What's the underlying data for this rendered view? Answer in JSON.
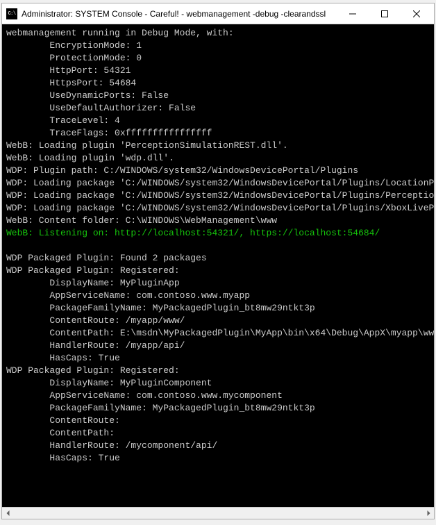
{
  "window": {
    "icon_label": "C:\\",
    "title": "Administrator:  SYSTEM Console - Careful! - webmanagement  -debug -clearandssl"
  },
  "console": {
    "lines": [
      {
        "text": "webmanagement running in Debug Mode, with:",
        "class": ""
      },
      {
        "text": "        EncryptionMode: 1",
        "class": ""
      },
      {
        "text": "        ProtectionMode: 0",
        "class": ""
      },
      {
        "text": "        HttpPort: 54321",
        "class": ""
      },
      {
        "text": "        HttpsPort: 54684",
        "class": ""
      },
      {
        "text": "        UseDynamicPorts: False",
        "class": ""
      },
      {
        "text": "        UseDefaultAuthorizer: False",
        "class": ""
      },
      {
        "text": "        TraceLevel: 4",
        "class": ""
      },
      {
        "text": "        TraceFlags: 0xffffffffffffffff",
        "class": ""
      },
      {
        "text": "WebB: Loading plugin 'PerceptionSimulationREST.dll'.",
        "class": ""
      },
      {
        "text": "WebB: Loading plugin 'wdp.dll'.",
        "class": ""
      },
      {
        "text": "WDP: Plugin path: C:/WINDOWS/system32/WindowsDevicePortal/Plugins",
        "class": ""
      },
      {
        "text": "WDP: Loading package 'C:/WINDOWS/system32/WindowsDevicePortal/Plugins/LocationPlugin",
        "class": ""
      },
      {
        "text": "WDP: Loading package 'C:/WINDOWS/system32/WindowsDevicePortal/Plugins/Perception/pac",
        "class": ""
      },
      {
        "text": "WDP: Loading package 'C:/WINDOWS/system32/WindowsDevicePortal/Plugins/XboxLivePlugin",
        "class": ""
      },
      {
        "text": "WebB: Content folder: C:\\WINDOWS\\WebManagement\\www",
        "class": ""
      },
      {
        "text": "WebB: Listening on: http://localhost:54321/, https://localhost:54684/",
        "class": "green"
      },
      {
        "text": "",
        "class": ""
      },
      {
        "text": "WDP Packaged Plugin: Found 2 packages",
        "class": ""
      },
      {
        "text": "WDP Packaged Plugin: Registered:",
        "class": ""
      },
      {
        "text": "        DisplayName: MyPluginApp",
        "class": ""
      },
      {
        "text": "        AppServiceName: com.contoso.www.myapp",
        "class": ""
      },
      {
        "text": "        PackageFamilyName: MyPackagedPlugin_bt8mw29ntkt3p",
        "class": ""
      },
      {
        "text": "        ContentRoute: /myapp/www/",
        "class": ""
      },
      {
        "text": "        ContentPath: E:\\msdn\\MyPackagedPlugin\\MyApp\\bin\\x64\\Debug\\AppX\\myapp\\www\\",
        "class": ""
      },
      {
        "text": "        HandlerRoute: /myapp/api/",
        "class": ""
      },
      {
        "text": "        HasCaps: True",
        "class": ""
      },
      {
        "text": "WDP Packaged Plugin: Registered:",
        "class": ""
      },
      {
        "text": "        DisplayName: MyPluginComponent",
        "class": ""
      },
      {
        "text": "        AppServiceName: com.contoso.www.mycomponent",
        "class": ""
      },
      {
        "text": "        PackageFamilyName: MyPackagedPlugin_bt8mw29ntkt3p",
        "class": ""
      },
      {
        "text": "        ContentRoute:",
        "class": ""
      },
      {
        "text": "        ContentPath:",
        "class": ""
      },
      {
        "text": "        HandlerRoute: /mycomponent/api/",
        "class": ""
      },
      {
        "text": "        HasCaps: True",
        "class": ""
      }
    ]
  }
}
